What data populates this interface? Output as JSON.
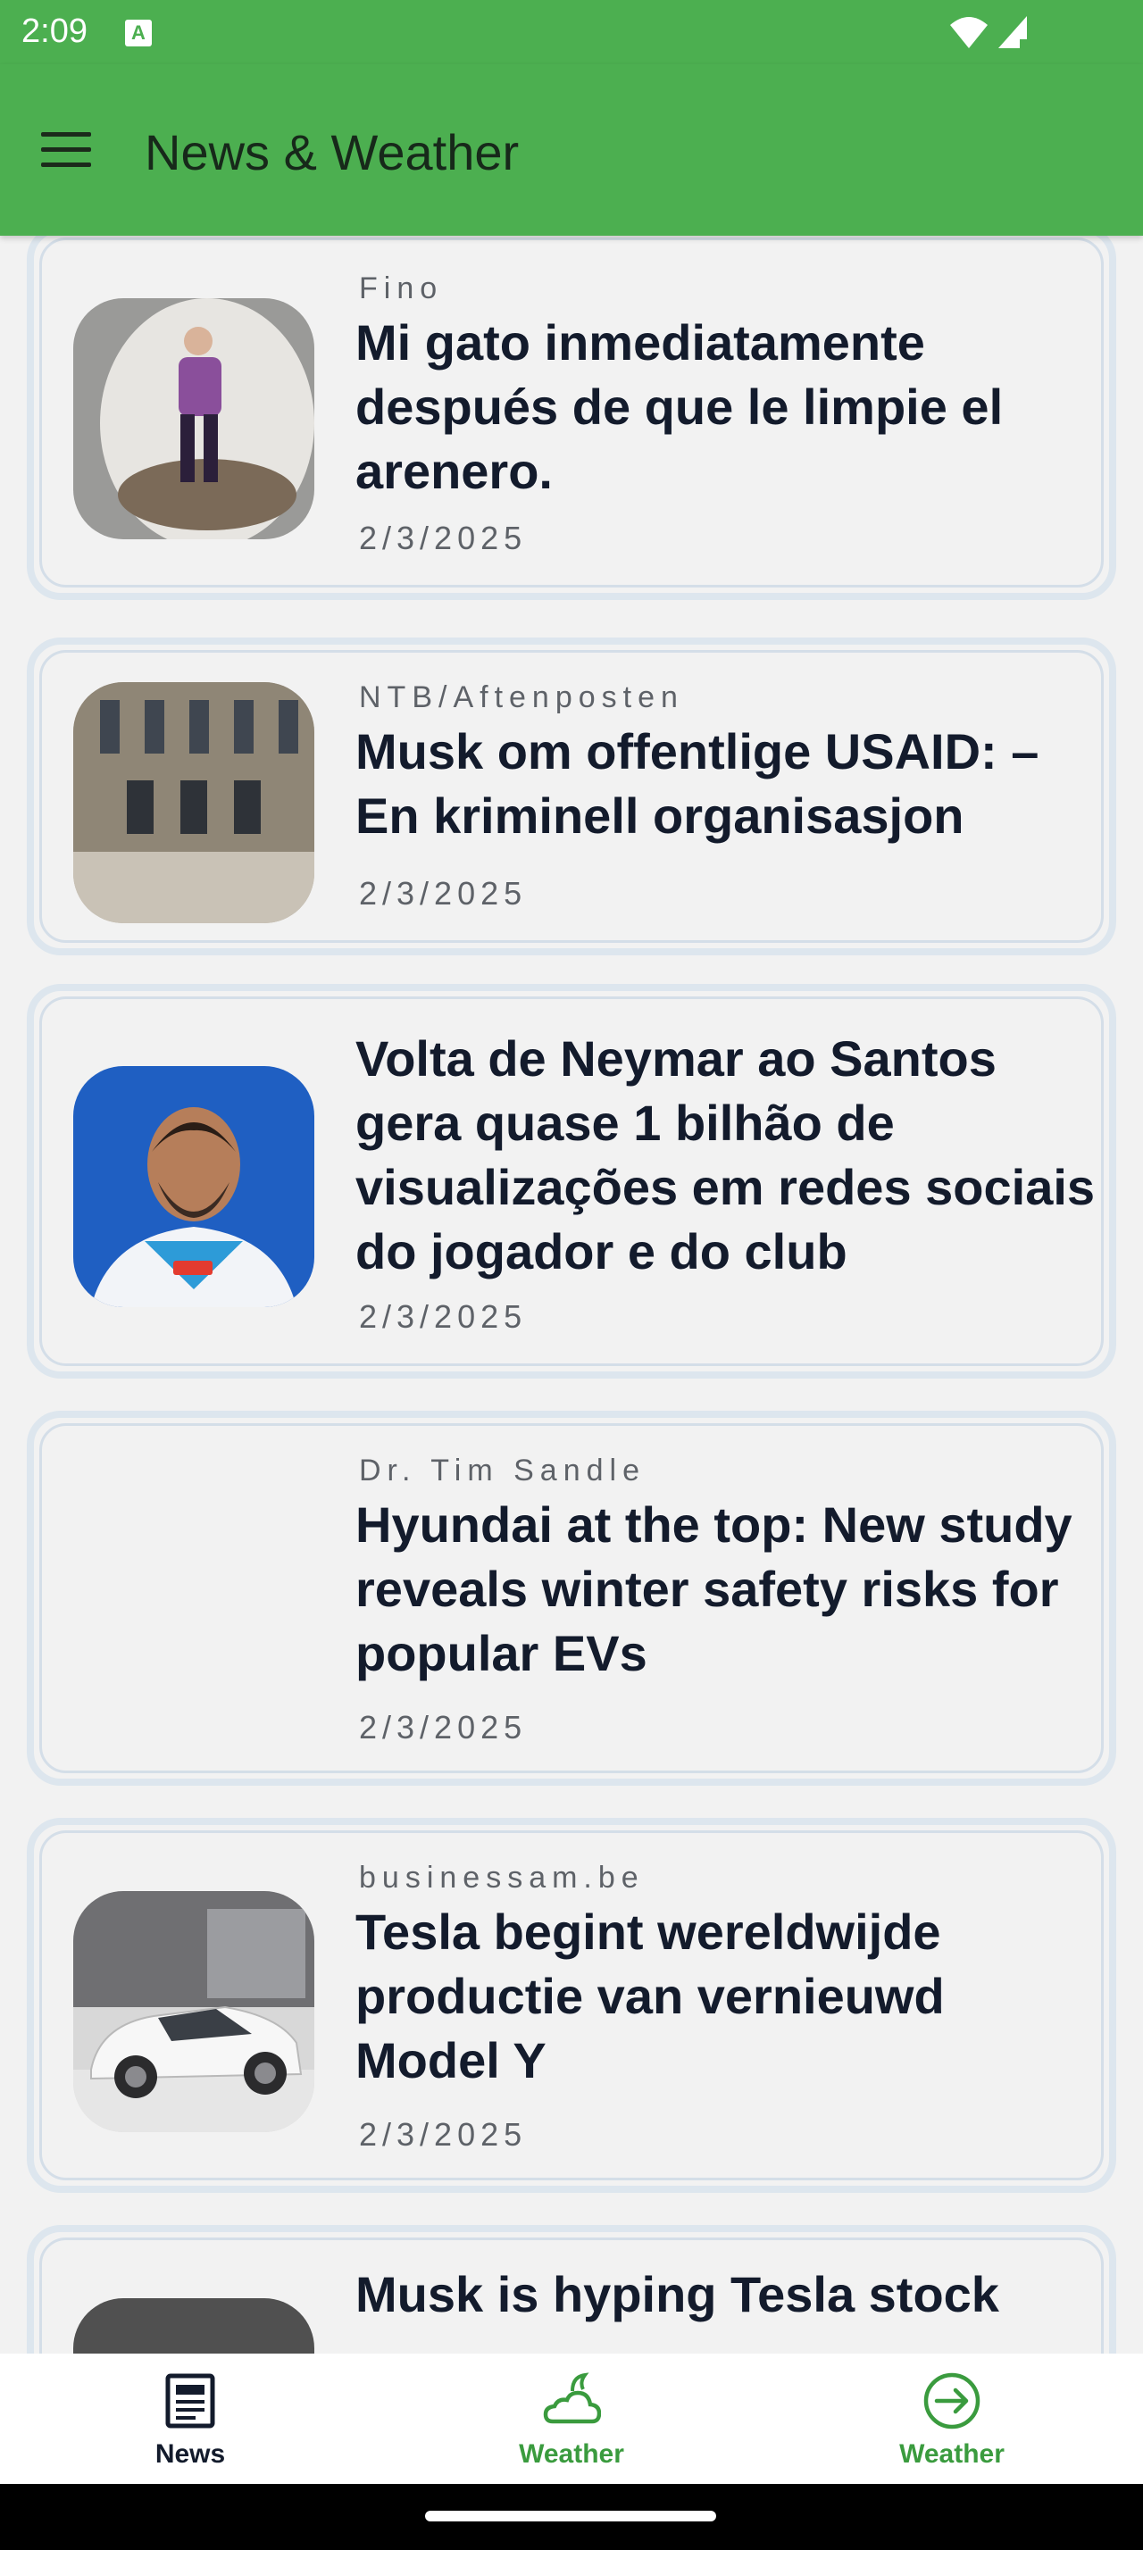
{
  "status_bar": {
    "time": "2:09",
    "notification_icon": "A"
  },
  "app_bar": {
    "title": "News & Weather",
    "menu_icon": "hamburger-menu-icon"
  },
  "articles": [
    {
      "source": "Fino",
      "title": "Mi gato inmediatamente después de que le limpie el arenero.",
      "date": "2/3/2025"
    },
    {
      "source": "NTB/Aftenposten",
      "title": "Musk om offentlige USAID: – En kriminell organisasjon",
      "date": "2/3/2025"
    },
    {
      "source": "",
      "title": "Volta de Neymar ao Santos gera quase 1 bilhão de visualizações em redes sociais do jogador e do club",
      "date": "2/3/2025"
    },
    {
      "source": "Dr. Tim Sandle",
      "title": "Hyundai at the top: New study reveals winter safety risks for popular EVs",
      "date": "2/3/2025"
    },
    {
      "source": "businessam.be",
      "title": "Tesla begint wereldwijde productie van vernieuwd Model Y",
      "date": "2/3/2025"
    },
    {
      "source": "",
      "title": "Musk is hyping Tesla stock",
      "date": ""
    }
  ],
  "bottom_nav": [
    {
      "label": "News",
      "icon": "newspaper-icon",
      "color": "#131b2c"
    },
    {
      "label": "Weather",
      "icon": "cloud-weather-icon",
      "color": "#3a9b3e"
    },
    {
      "label": "Weather",
      "icon": "arrow-circle-icon",
      "color": "#3a9b3e"
    }
  ],
  "colors": {
    "primary": "#4caf50",
    "accent": "#3a9b3e",
    "card_border": "#dde6ee"
  }
}
